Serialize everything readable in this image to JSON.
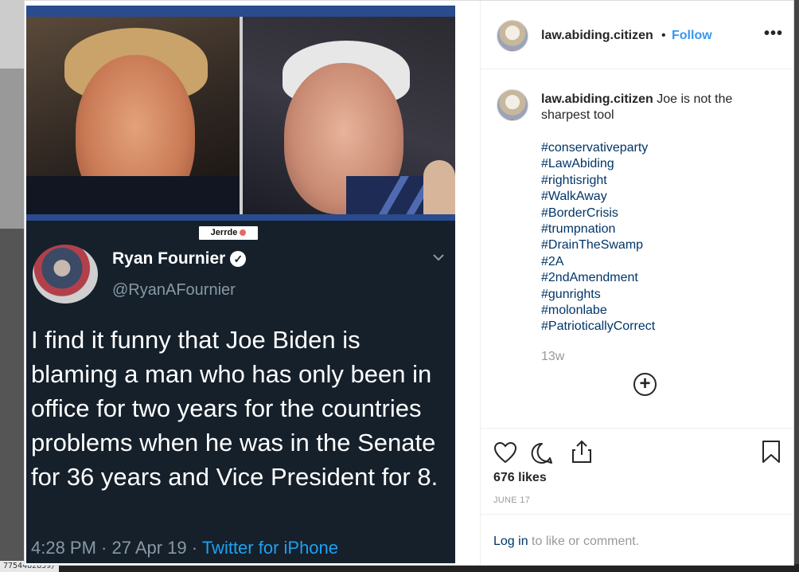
{
  "url_fragment": "7754482859/",
  "media": {
    "watermark": "Jerrde",
    "tweet": {
      "name": "Ryan Fournier",
      "handle": "@RyanAFournier",
      "text": "I find it funny that Joe Biden is blaming a man who has only been in office for two years for the countries problems when he was in the Senate for 36 years and Vice President for 8.",
      "time_date": "4:28 PM · 27 Apr 19 · ",
      "source": "Twitter for iPhone"
    }
  },
  "header": {
    "username": "law.abiding.citizen",
    "separator": "•",
    "follow_label": "Follow",
    "more_label": "•••"
  },
  "caption": {
    "username": "law.abiding.citizen",
    "text": "Joe is not the sharpest tool",
    "hashtags": [
      "#conservativeparty",
      "#LawAbiding",
      "#rightisright",
      "#WalkAway",
      "#BorderCrisis",
      "#trumpnation",
      "#DrainTheSwamp",
      "#2A",
      "#2ndAmendment",
      "#gunrights",
      "#molonlabe",
      "#PatrioticallyCorrect"
    ],
    "age": "13w",
    "load_more_icon": "plus-circle-icon"
  },
  "actions": {
    "like_icon": "heart-icon",
    "comment_icon": "comment-icon",
    "share_icon": "share-icon",
    "save_icon": "bookmark-icon"
  },
  "likes": "676 likes",
  "date": "JUNE 17",
  "login": {
    "link": "Log in",
    "rest": " to like or comment."
  },
  "colors": {
    "link_blue": "#3897f0",
    "hashtag": "#003569",
    "tweet_bg": "#15202b",
    "tweet_link": "#1da1f2"
  }
}
